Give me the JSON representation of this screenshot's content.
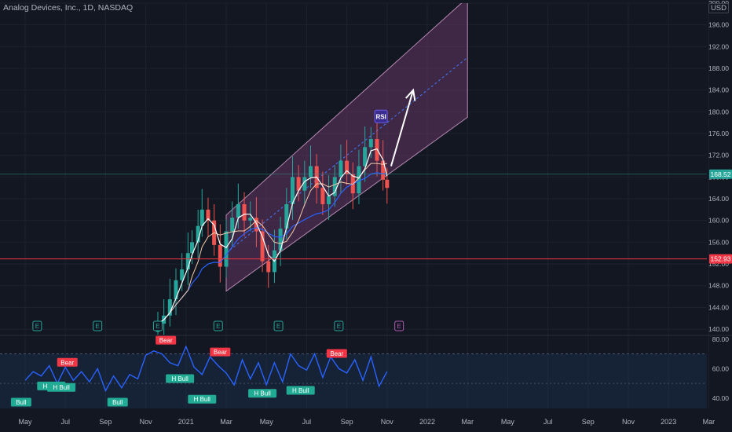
{
  "header": {
    "title": "Analog Devices, Inc., 1D, NASDAQ",
    "currency": "USD"
  },
  "colors": {
    "background": "#131722",
    "grid": "#1e222d",
    "up_candle": "#26a69a",
    "down_candle": "#ef5350",
    "channel_fill": "#7b3f7a",
    "channel_edge": "#b58ab0",
    "channel_mid": "#3d7bff",
    "ma_fast": "#ffffff",
    "ma_mid": "#f2c9a8",
    "ma_slow": "#2962ff",
    "support_line": "#f23645",
    "price_line": "#26a69a",
    "rsi_line": "#2962ff",
    "rsi_band": "#1e3a5f",
    "bear_label": "#f23645",
    "bull_label": "#22ab94",
    "earnings_green": "#26a69a",
    "earnings_purple": "#b05ab0",
    "arrow": "#ffffff"
  },
  "chart_data": [
    {
      "type": "candlestick",
      "x_ticks": [
        "May",
        "Jul",
        "Sep",
        "Nov",
        "2021",
        "Mar",
        "May",
        "Jul",
        "Sep",
        "Nov",
        "2022",
        "Mar",
        "May",
        "Jul",
        "Sep",
        "Nov",
        "2023",
        "Mar"
      ],
      "x_tick_months": [
        0,
        2,
        4,
        6,
        8,
        10,
        12,
        14,
        16,
        18,
        20,
        22,
        24,
        26,
        28,
        30,
        32,
        34
      ],
      "x_start_month": "2020-05",
      "y_ticks": [
        "200.00",
        "196.00",
        "192.00",
        "188.00",
        "184.00",
        "180.00",
        "176.00",
        "172.00",
        "168.00",
        "164.00",
        "160.00",
        "156.00",
        "152.00",
        "148.00",
        "144.00",
        "140.00"
      ],
      "ylim": [
        139,
        200
      ],
      "price_labels": [
        {
          "value": 168.52,
          "text": "168.52",
          "kind": "price_line"
        },
        {
          "value": 152.93,
          "text": "152.93",
          "kind": "support_line"
        }
      ],
      "price_series": {
        "month": [
          6.6,
          6.9,
          7.2,
          7.5,
          7.8,
          8.1,
          8.3,
          8.6,
          8.8,
          9.1,
          9.4,
          9.7,
          10.0,
          10.3,
          10.6,
          10.9,
          11.2,
          11.5,
          11.8,
          12.1,
          12.4,
          12.7,
          13.0,
          13.3,
          13.6,
          13.9,
          14.2,
          14.5,
          14.8,
          15.1,
          15.4,
          15.7,
          16.0,
          16.3,
          16.6,
          16.9,
          17.2,
          17.5,
          17.8,
          18.0
        ],
        "close": [
          141.0,
          142.5,
          145.5,
          149.0,
          151.0,
          154.0,
          156.0,
          159.0,
          162.0,
          160.0,
          155.5,
          151.5,
          158.0,
          160.5,
          163.0,
          160.0,
          160.5,
          158.0,
          152.5,
          150.5,
          154.5,
          158.5,
          163.0,
          168.0,
          165.5,
          168.0,
          170.0,
          166.0,
          163.0,
          164.5,
          168.0,
          171.0,
          168.5,
          165.0,
          170.0,
          173.5,
          175.0,
          171.0,
          167.5,
          166.0
        ]
      },
      "channel": {
        "lower_start": {
          "month": 10.0,
          "value": 147.0
        },
        "lower_end": {
          "month": 22.0,
          "value": 179.0
        },
        "upper_start": {
          "month": 10.0,
          "value": 161.0
        },
        "upper_end": {
          "month": 22.0,
          "value": 201.0
        },
        "mid_start": {
          "month": 10.0,
          "value": 154.0
        },
        "mid_end": {
          "month": 22.0,
          "value": 190.0
        }
      },
      "support_value": 152.93,
      "price_line_value": 168.52,
      "annotations": [
        {
          "label": "RSI",
          "month": 17.7,
          "value": 179.0
        }
      ],
      "earnings_markers": [
        {
          "month": 0.6,
          "label": "E",
          "kind": "green"
        },
        {
          "month": 3.6,
          "label": "E",
          "kind": "green"
        },
        {
          "month": 6.6,
          "label": "E",
          "kind": "green"
        },
        {
          "month": 9.6,
          "label": "E",
          "kind": "green"
        },
        {
          "month": 12.6,
          "label": "E",
          "kind": "green"
        },
        {
          "month": 15.6,
          "label": "E",
          "kind": "green"
        },
        {
          "month": 18.6,
          "label": "E",
          "kind": "purple"
        }
      ],
      "projection_arrow": {
        "from_month": 18.2,
        "from_value": 170.0,
        "to_month": 19.3,
        "to_value": 184.0
      }
    },
    {
      "type": "line",
      "name": "RSI",
      "y_ticks": [
        "80.00",
        "60.00",
        "40.00"
      ],
      "ylim": [
        33,
        82
      ],
      "band": [
        30,
        70
      ],
      "middle": 50,
      "x_month": [
        0.0,
        0.4,
        0.8,
        1.2,
        1.6,
        2.0,
        2.4,
        2.8,
        3.2,
        3.6,
        4.0,
        4.4,
        4.8,
        5.2,
        5.6,
        6.0,
        6.4,
        6.8,
        7.2,
        7.6,
        8.0,
        8.4,
        8.8,
        9.2,
        9.6,
        10.0,
        10.4,
        10.8,
        11.2,
        11.6,
        12.0,
        12.4,
        12.8,
        13.2,
        13.6,
        14.0,
        14.4,
        14.8,
        15.2,
        15.6,
        16.0,
        16.4,
        16.8,
        17.2,
        17.6,
        18.0
      ],
      "values": [
        52,
        58,
        55,
        62,
        50,
        61,
        52,
        58,
        51,
        60,
        45,
        55,
        47,
        56,
        53,
        69,
        72,
        70,
        64,
        62,
        75,
        61,
        56,
        68,
        62,
        57,
        49,
        66,
        53,
        64,
        49,
        64,
        51,
        70,
        62,
        59,
        70,
        54,
        68,
        60,
        57,
        66,
        52,
        68,
        48,
        58
      ],
      "labels": [
        {
          "text": "Bear",
          "month": 2.1,
          "value": 64,
          "kind": "bear"
        },
        {
          "text": "H Bull",
          "month": 1.3,
          "value": 48,
          "kind": "bull"
        },
        {
          "text": "H Bull",
          "month": 1.8,
          "value": 47,
          "kind": "bull"
        },
        {
          "text": "Bull",
          "month": -0.2,
          "value": 37,
          "kind": "bull"
        },
        {
          "text": "Bull",
          "month": 4.6,
          "value": 37,
          "kind": "bull"
        },
        {
          "text": "Bear",
          "month": 7.0,
          "value": 79,
          "kind": "bear"
        },
        {
          "text": "H Bull",
          "month": 7.7,
          "value": 53,
          "kind": "bull"
        },
        {
          "text": "H Bull",
          "month": 8.8,
          "value": 39,
          "kind": "bull"
        },
        {
          "text": "Bear",
          "month": 9.7,
          "value": 71,
          "kind": "bear"
        },
        {
          "text": "H Bull",
          "month": 11.8,
          "value": 43,
          "kind": "bull"
        },
        {
          "text": "H Bull",
          "month": 13.7,
          "value": 45,
          "kind": "bull"
        },
        {
          "text": "Bear",
          "month": 15.5,
          "value": 70,
          "kind": "bear"
        }
      ]
    }
  ]
}
